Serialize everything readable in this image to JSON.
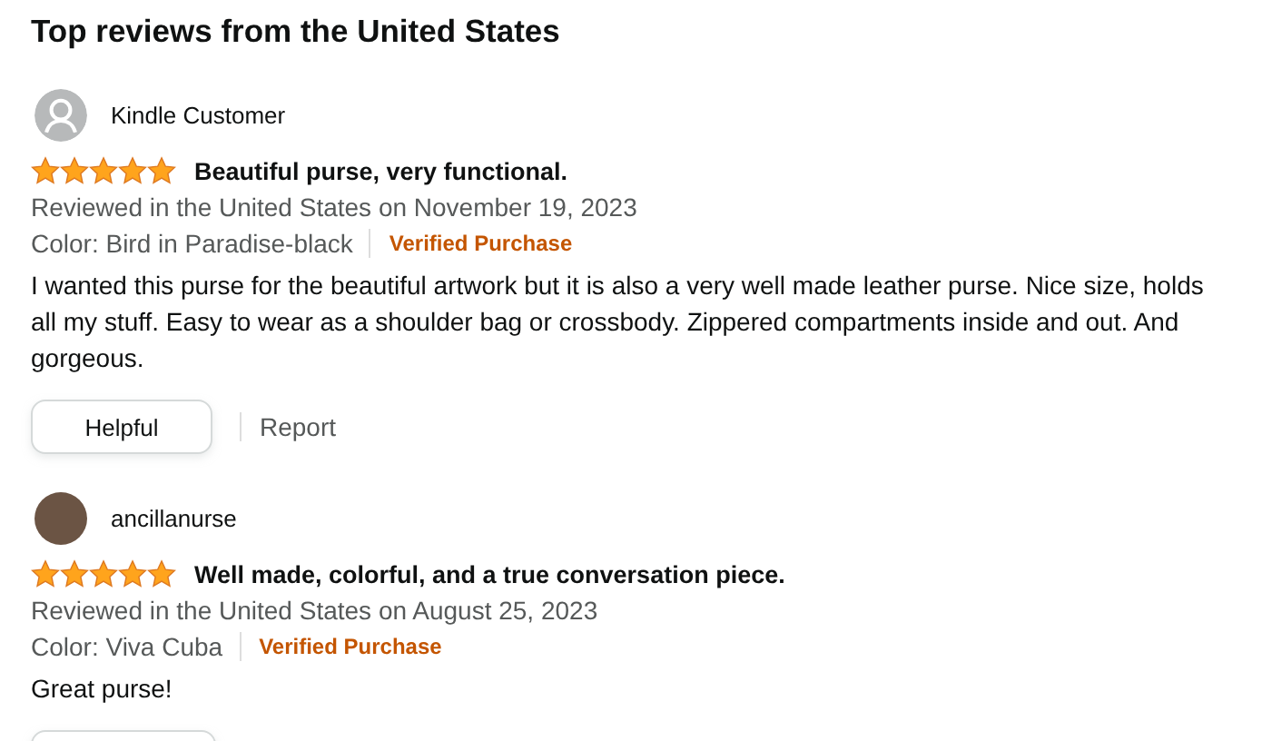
{
  "heading": "Top reviews from the United States",
  "reviews": [
    {
      "avatar": {
        "kind": "silhouette"
      },
      "name": "Kindle Customer",
      "stars": 5,
      "title": "Beautiful purse, very functional.",
      "date": "Reviewed in the United States on November 19, 2023",
      "variant": "Color: Bird in Paradise-black",
      "verified": "Verified Purchase",
      "body": "I wanted this purse for the beautiful artwork but it is also a very well made leather purse. Nice size, holds all my stuff. Easy to wear as a shoulder bag or crossbody. Zippered compartments inside and out. And gorgeous.",
      "helpful": "Helpful",
      "report": "Report"
    },
    {
      "avatar": {
        "kind": "photo"
      },
      "name": "ancillanurse",
      "stars": 5,
      "title": "Well made, colorful, and a true conversation piece.",
      "date": "Reviewed in the United States on August 25, 2023",
      "variant": "Color: Viva Cuba",
      "verified": "Verified Purchase",
      "body": "Great purse!",
      "button_cut_off": true
    }
  ]
}
